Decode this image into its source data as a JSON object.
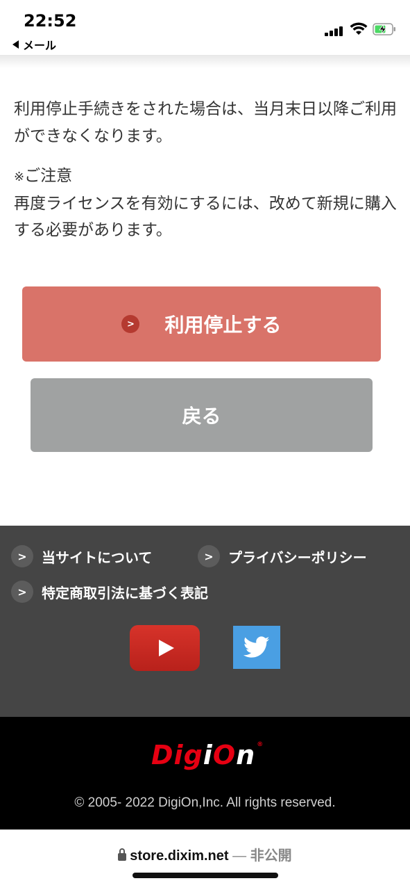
{
  "status_bar": {
    "time": "22:52",
    "back_app": "メール",
    "icons": [
      "signal-icon",
      "wifi-icon",
      "battery-charging-icon"
    ]
  },
  "content": {
    "message": "利用停止手続きをされた場合は、当月末日以降ご利用ができなくなります。",
    "notice_mark": "※",
    "notice_title": "ご注意",
    "notice_body": "再度ライセンスを有効にするには、改めて新規に購入する必要があります。"
  },
  "buttons": {
    "stop_label": "利用停止する",
    "back_label": "戻る"
  },
  "footer": {
    "links": [
      "当サイトについて",
      "プライバシーポリシー",
      "特定商取引法に基づく表記"
    ],
    "social": [
      "youtube-icon",
      "twitter-icon"
    ],
    "logo_text": "DigiOn",
    "copyright": "© 2005- 2022 DigiOn,Inc. All rights reserved."
  },
  "url_bar": {
    "domain": "store.dixim.net",
    "separator": "—",
    "status": "非公開"
  },
  "colors": {
    "stop_button": "#d97369",
    "back_button": "#a0a2a2",
    "footer_links_bg": "#454545",
    "brand_footer_bg": "#000000",
    "logo_red": "#e60012",
    "twitter": "#4a9fe3",
    "youtube": "#c8281f"
  }
}
